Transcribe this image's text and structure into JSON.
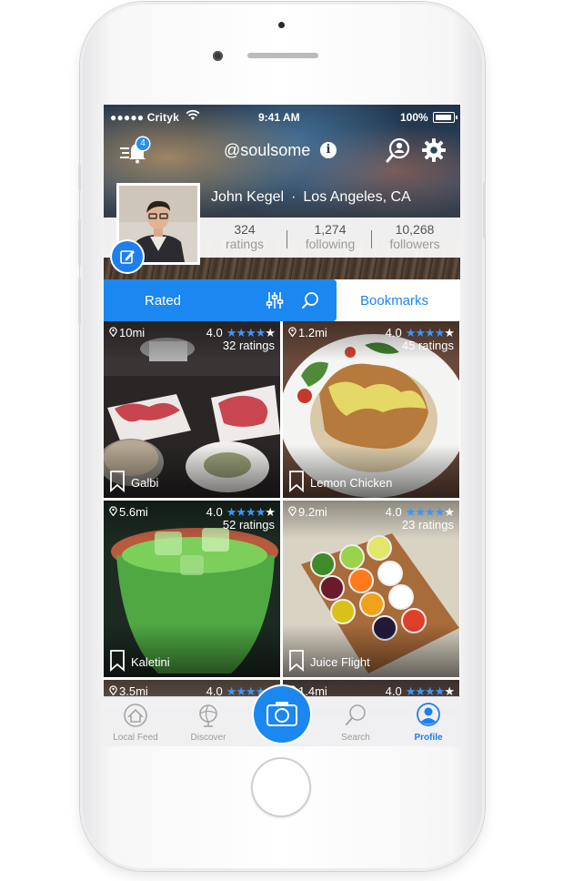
{
  "status_bar": {
    "carrier": "●●●●● Crityk",
    "time": "9:41 AM",
    "battery": "100%"
  },
  "header": {
    "notification_count": "4",
    "username": "@soulsome",
    "info_glyph": "i"
  },
  "profile": {
    "name": "John Kegel",
    "separator": "·",
    "location": "Los Angeles, CA",
    "stats": [
      {
        "value": "324",
        "label": "ratings"
      },
      {
        "value": "1,274",
        "label": "following"
      },
      {
        "value": "10,268",
        "label": "followers"
      }
    ]
  },
  "tabs": {
    "rated": "Rated",
    "bookmarks": "Bookmarks"
  },
  "cards": [
    {
      "distance": "10mi",
      "score": "4.0",
      "stars": 4,
      "count": "32 ratings",
      "title": "Galbi"
    },
    {
      "distance": "1.2mi",
      "score": "4.0",
      "stars": 4,
      "count": "45 ratings",
      "title": "Lemon Chicken"
    },
    {
      "distance": "5.6mi",
      "score": "4.0",
      "stars": 4,
      "count": "52 ratings",
      "title": "Kaletini"
    },
    {
      "distance": "9.2mi",
      "score": "4.0",
      "stars": 4,
      "count": "23 ratings",
      "title": "Juice Flight"
    },
    {
      "distance": "3.5mi",
      "score": "4.0",
      "stars": 4,
      "count": "",
      "title": ""
    },
    {
      "distance": "1.4mi",
      "score": "4.0",
      "stars": 4,
      "count": "",
      "title": ""
    }
  ],
  "tab_bar": {
    "items": [
      {
        "label": "Local Feed",
        "icon": "home-icon"
      },
      {
        "label": "Discover",
        "icon": "globe-icon"
      },
      {
        "label": "Search",
        "icon": "search-icon"
      },
      {
        "label": "Profile",
        "icon": "profile-icon"
      }
    ]
  },
  "colors": {
    "accent": "#1b87f0",
    "star": "#3e95f5"
  }
}
